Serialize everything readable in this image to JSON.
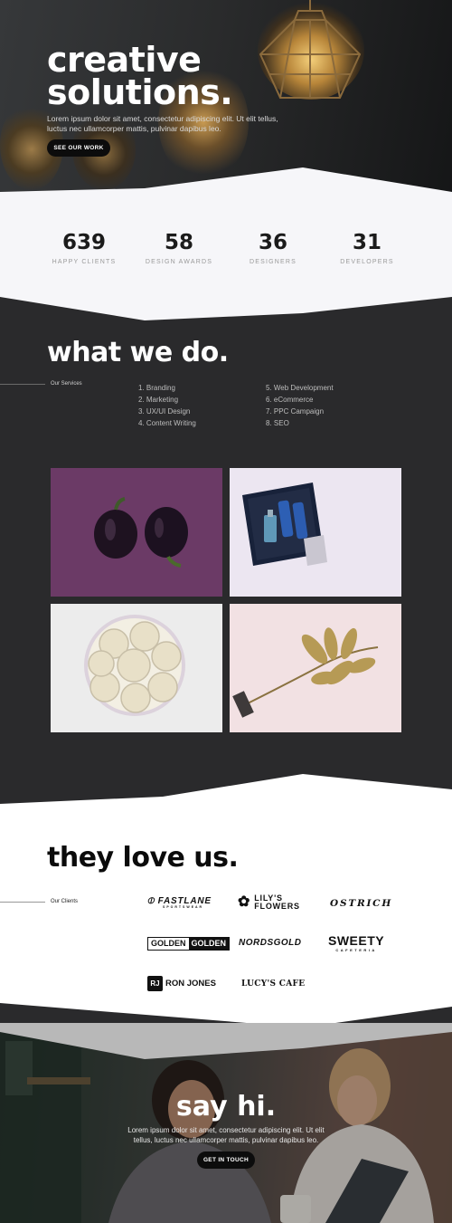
{
  "hero": {
    "title_line1": "creative",
    "title_line2": "solutions.",
    "subtitle": "Lorem ipsum dolor sit amet, consectetur adipiscing elit. Ut elit tellus, luctus nec ullamcorper mattis, pulvinar dapibus leo.",
    "button_label": "SEE OUR WORK"
  },
  "stats": [
    {
      "value": "639",
      "label": "HAPPY CLIENTS"
    },
    {
      "value": "58",
      "label": "DESIGN AWARDS"
    },
    {
      "value": "36",
      "label": "DESIGNERS"
    },
    {
      "value": "31",
      "label": "DEVELOPERS"
    }
  ],
  "services": {
    "title": "what we do.",
    "side_label": "Our Services",
    "col1": [
      "1. Branding",
      "2. Marketing",
      "3. UX/UI Design",
      "4. Content Writing"
    ],
    "col2": [
      "5. Web Development",
      "6. eCommerce",
      "7. PPC Campaign",
      "8. SEO"
    ]
  },
  "clients": {
    "title": "they love us.",
    "side_label": "Our Clients",
    "logos": {
      "fastlane": "FASTLANE",
      "fastlane_sub": "SPORTSWEAR",
      "lily_line1": "LILY'S",
      "lily_line2": "FLOWERS",
      "ostrich": "OSTRICH",
      "golden_a": "GOLDEN",
      "golden_b": "GOLDEN",
      "nordsgold": "NORDSGOLD",
      "sweety": "SWEETY",
      "sweety_sub": "CAFETERIA",
      "rj_mark": "RJ",
      "ronjones": "RON JONES",
      "lucys": "LUCY'S CAFE"
    }
  },
  "contact": {
    "title": "say hi.",
    "subtitle": "Lorem ipsum dolor sit amet, consectetur adipiscing elit. Ut elit tellus, luctus nec ullamcorper mattis, pulvinar dapibus leo.",
    "button_label": "GET IN TOUCH"
  },
  "colors": {
    "dark_bg": "#2a2a2c",
    "light_bg": "#f6f6f9",
    "white": "#ffffff",
    "accent_dark": "#0c0c0c"
  }
}
